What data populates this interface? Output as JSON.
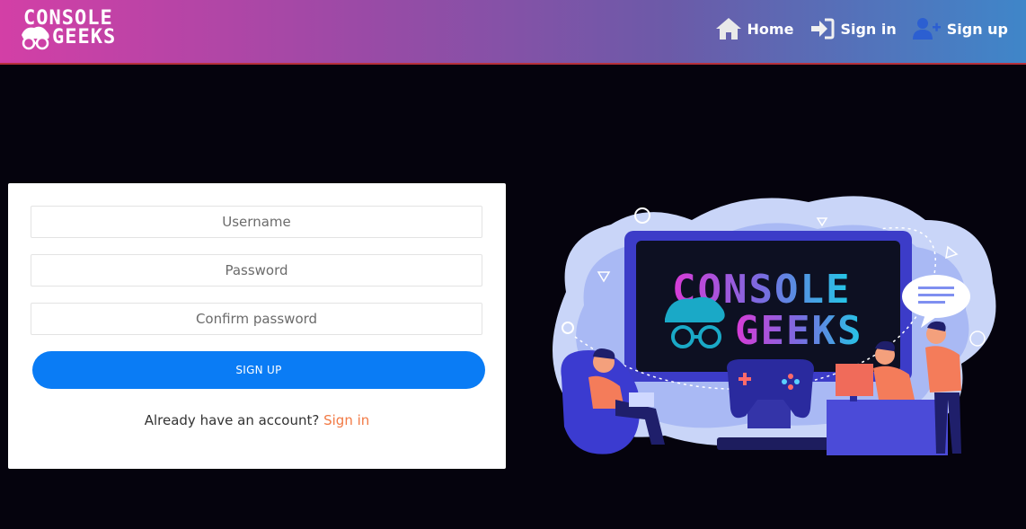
{
  "brand": {
    "line1": "CONSOLE",
    "line2": "GEEKS",
    "logo_icon": "geek-face-icon"
  },
  "nav": {
    "home_label": "Home",
    "home_icon": "home-icon",
    "signin_label": "Sign in",
    "signin_icon": "sign-in-icon",
    "signup_label": "Sign up",
    "signup_icon": "user-plus-icon"
  },
  "form": {
    "username_placeholder": "Username",
    "password_placeholder": "Password",
    "confirm_placeholder": "Confirm password",
    "submit_label": "SIGN UP",
    "already_text": "Already have an account? ",
    "signin_link": "Sign in"
  },
  "illustration": {
    "screen_line1": "CONSOLE",
    "screen_line2": "GEEKS"
  },
  "colors": {
    "navbar_start": "#d33fa6",
    "navbar_end": "#3f86c9",
    "button": "#0a7cf5",
    "link": "#f27a45",
    "background": "#05030d"
  }
}
